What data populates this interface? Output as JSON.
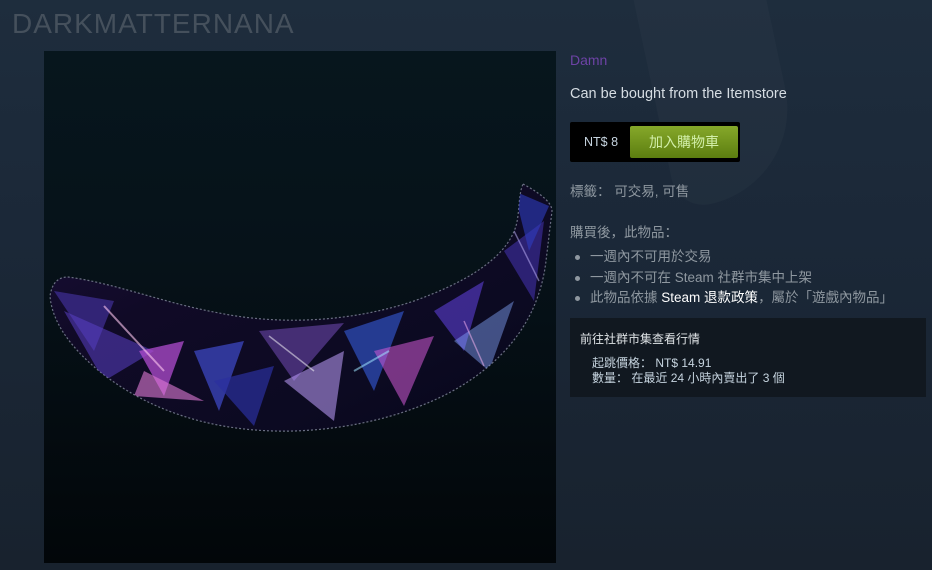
{
  "item": {
    "title": "DARKMATTERNANA",
    "type": "Damn",
    "description": "Can be bought from the Itemstore"
  },
  "purchase": {
    "price": "NT$ 8",
    "add_to_cart_label": "加入購物車"
  },
  "tags": {
    "label": "標籤：",
    "value": "可交易, 可售"
  },
  "after_purchase": {
    "heading": "購買後，此物品：",
    "items": [
      "一週內不可用於交易",
      "一週內不可在 Steam 社群市集中上架"
    ],
    "refund_prefix": "此物品依據 ",
    "refund_steam": "Steam",
    "refund_link": " 退款政策",
    "refund_suffix": "，屬於「遊戲內物品」"
  },
  "market": {
    "link_label": "前往社群市集查看行情",
    "starting_price_label": "起跳價格：",
    "starting_price": "NT$ 14.91",
    "volume_label": "數量：",
    "volume_text": "在最近 24 小時內賣出了 3 個"
  },
  "colors": {
    "background": "#1b2838",
    "type_color": "#6d43a6",
    "cart_button": "#6f9219"
  }
}
